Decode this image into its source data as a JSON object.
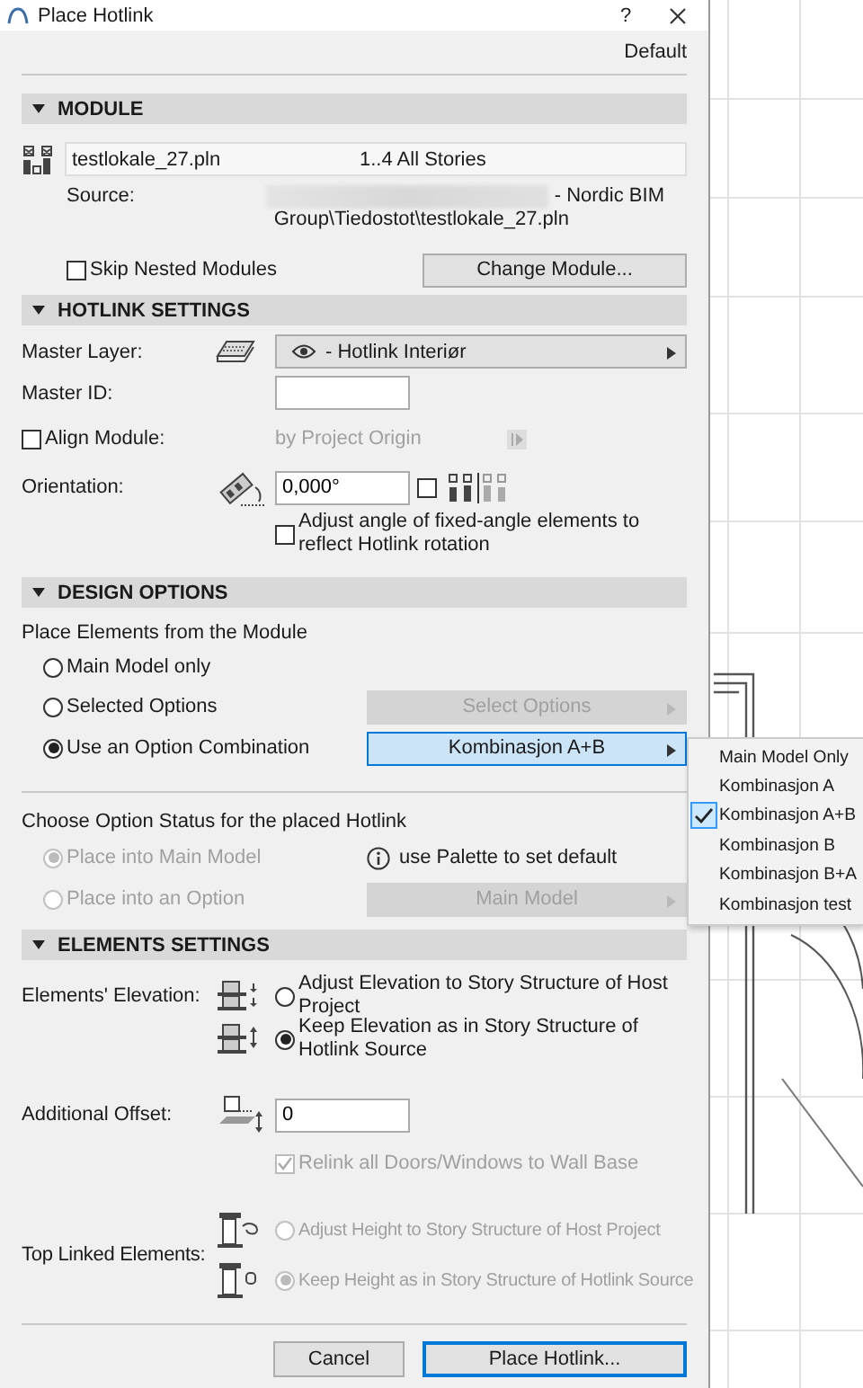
{
  "window": {
    "title": "Place Hotlink",
    "help_button": "?"
  },
  "preset": "Default",
  "module": {
    "header": "MODULE",
    "expanded": true,
    "file": "testlokale_27.pln",
    "stories": "1..4 All Stories",
    "source_label": "Source:",
    "source_path": [
      "- Nordic BIM",
      "Group\\Tiedostot\\testlokale_27.pln"
    ],
    "skip_nested": {
      "label": "Skip Nested Modules",
      "checked": false
    },
    "change_button": "Change Module..."
  },
  "hotlink_settings": {
    "header": "HOTLINK SETTINGS",
    "expanded": true,
    "master_layer": {
      "label": "Master Layer:",
      "value": "- Hotlink Interiør"
    },
    "master_id": {
      "label": "Master ID:"
    },
    "align_module": {
      "label": "Align Module:",
      "checked": false,
      "value": "by Project Origin"
    },
    "orientation": {
      "label": "Orientation:",
      "value": "0,000°",
      "mirror_checked": false
    },
    "adjust_angle": {
      "label": "Adjust angle of fixed-angle elements to reflect Hotlink rotation",
      "checked": false
    }
  },
  "design_options": {
    "header": "DESIGN OPTIONS",
    "expanded": true,
    "intro": "Place Elements from the Module",
    "place_options": [
      {
        "label": "Main Model only",
        "selected": false
      },
      {
        "label": "Selected Options",
        "selected": false,
        "button": "Select Options",
        "button_disabled": true
      },
      {
        "label": "Use an Option Combination",
        "selected": true,
        "button": "Kombinasjon A+B",
        "button_disabled": false
      }
    ],
    "status_title": "Choose Option Status for the placed Hotlink",
    "status_options": [
      {
        "label": "Place into Main Model",
        "selected": true,
        "disabled": true,
        "info": "use Palette to set default"
      },
      {
        "label": "Place into an Option",
        "selected": false,
        "disabled": true,
        "button": "Main Model"
      }
    ]
  },
  "elements_settings": {
    "header": "ELEMENTS SETTINGS",
    "expanded": true,
    "elevation_label": "Elements' Elevation:",
    "elevation_options": [
      {
        "label": "Adjust Elevation to Story Structure of Host Project",
        "selected": false,
        "disabled": false
      },
      {
        "label": "Keep Elevation as in Story Structure of Hotlink Source",
        "selected": true,
        "disabled": false
      }
    ],
    "offset_label": "Additional Offset:",
    "offset_value": "0",
    "relink": {
      "label": "Relink all Doors/Windows to Wall Base",
      "checked": true,
      "disabled": true
    },
    "top_linked_label": "Top Linked Elements:",
    "top_options": [
      {
        "label": "Adjust Height to Story Structure of Host Project",
        "selected": false,
        "disabled": true
      },
      {
        "label": "Keep Height as in Story Structure of Hotlink Source",
        "selected": true,
        "disabled": true
      }
    ]
  },
  "buttons": [
    {
      "label": "Cancel",
      "default": false
    },
    {
      "label": "Place Hotlink...",
      "default": true
    }
  ],
  "combination_menu": {
    "items": [
      {
        "label": "Main Model Only",
        "selected": false
      },
      {
        "label": "Kombinasjon A",
        "selected": false
      },
      {
        "label": "Kombinasjon A+B",
        "selected": true
      },
      {
        "label": "Kombinasjon B",
        "selected": false
      },
      {
        "label": "Kombinasjon B+A",
        "selected": false
      },
      {
        "label": "Kombinasjon test",
        "selected": false
      }
    ]
  }
}
